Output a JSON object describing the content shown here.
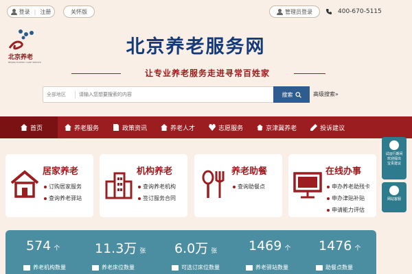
{
  "topbar": {
    "login_label": "登录",
    "register_label": "注册",
    "care_mode_label": "关怀版",
    "admin_login_label": "管理员登录",
    "phone": "400-670-5115"
  },
  "header": {
    "logo_text": "北京养老",
    "logo_subtext": "BEIJING ELDERLY CARE SERVICE",
    "title": "北京养老服务网",
    "slogan": "让专业养老服务走进寻常百姓家"
  },
  "search": {
    "region_label": "全部地区",
    "placeholder": "请输入您想要搜索的内容",
    "button_label": "搜索",
    "advanced_label": "高级搜索»"
  },
  "nav": {
    "items": [
      {
        "label": "首页",
        "icon": "home-icon"
      },
      {
        "label": "养老服务",
        "icon": "hand-icon"
      },
      {
        "label": "政策资讯",
        "icon": "doc-icon"
      },
      {
        "label": "养老人才",
        "icon": "people-icon"
      },
      {
        "label": "志愿服务",
        "icon": "heart-icon"
      },
      {
        "label": "京津冀养老",
        "icon": "nodes-icon"
      },
      {
        "label": "投诉建议",
        "icon": "edit-icon"
      }
    ]
  },
  "cards": [
    {
      "title": "居家养老",
      "icon": "house-icon",
      "items": [
        "订购居家服务",
        "查询养老驿站"
      ]
    },
    {
      "title": "机构养老",
      "icon": "building-icon",
      "items": [
        "查询养老机构",
        "签订服务合同"
      ]
    },
    {
      "title": "养老助餐",
      "icon": "fork-spoon-icon",
      "items": [
        "查询助餐点"
      ]
    },
    {
      "title": "在线办事",
      "icon": "monitor-icon",
      "items": [
        "申办养老助残卡",
        "申办津贴补贴",
        "申请能力评估"
      ]
    }
  ],
  "stats": [
    {
      "value": "574",
      "unit": "个",
      "label": "养老机构数量"
    },
    {
      "value": "11.3万",
      "unit": "张",
      "label": "养老床位数量"
    },
    {
      "value": "6.0万",
      "unit": "张",
      "label": "可选订床位数量"
    },
    {
      "value": "1469",
      "unit": "个",
      "label": "养老驿站数量"
    },
    {
      "value": "1476",
      "unit": "个",
      "label": "助餐点数量"
    }
  ],
  "float": {
    "survey": [
      "试运行期间",
      "欢迎提出",
      "宝贵建议"
    ],
    "service_label": "网站客服"
  },
  "colors": {
    "background": "#f9efe6",
    "nav": "#9b1d20",
    "title_blue": "#143a7a",
    "search_button": "#2f5c8f",
    "stats_bg": "#4c8ea1"
  }
}
